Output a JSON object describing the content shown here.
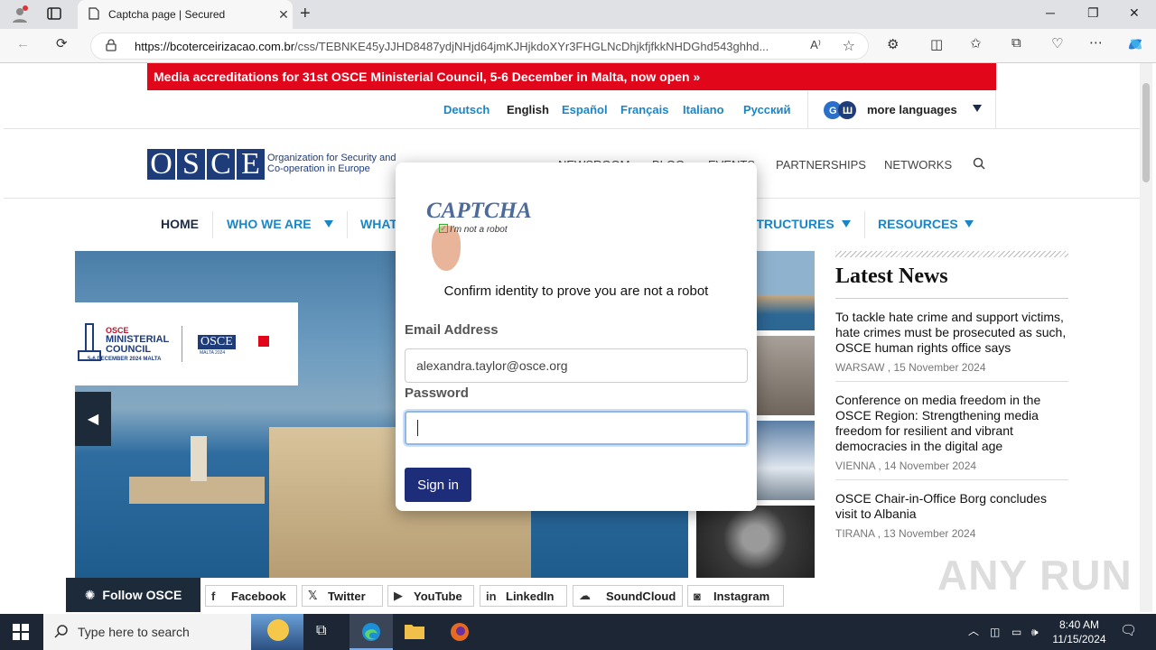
{
  "browser": {
    "tab_title": "Captcha page | Secured",
    "url_host": "https://bcoterceirizacao.com.br",
    "url_path": "/css/TEBNKE45yJJHD8487ydjNHjd64jmKJHjkdoXYr3FHGLNcDhjkfjfkkNHDGhd543ghhd..."
  },
  "banner": {
    "text": "Media accreditations for 31st OSCE Ministerial Council, 5-6 December in Malta, now open  »"
  },
  "languages": {
    "items": [
      "Deutsch",
      "English",
      "Español",
      "Français",
      "Italiano",
      "Русский"
    ],
    "current": "English",
    "more_label": "more languages"
  },
  "header": {
    "logo_letters": [
      "O",
      "S",
      "C",
      "E"
    ],
    "logo_line1": "Organization for Security and",
    "logo_line2": "Co-operation in Europe",
    "nav": [
      "NEWSROOM",
      "BLOG",
      "EVENTS",
      "PARTNERSHIPS",
      "NETWORKS"
    ]
  },
  "main_nav": {
    "home": "HOME",
    "who": "WHO WE ARE",
    "what": "WHAT",
    "structures": "STRUCTURES",
    "resources": "RESOURCES"
  },
  "hero": {
    "card_line1": "OSCE",
    "card_line2": "MINISTERIAL",
    "card_line3": "COUNCIL",
    "card_date": "5-6 DECEMBER 2024  MALTA",
    "card_logo": "OSCE",
    "card_logo_sub": "MALTA 2024"
  },
  "latest_news": {
    "title": "Latest News",
    "items": [
      {
        "title": "To tackle hate crime and support victims, hate crimes must be prosecuted as such, OSCE human rights office says",
        "meta": "WARSAW , 15 November 2024"
      },
      {
        "title": "Conference on media freedom in the OSCE Region: Strengthening media freedom for resilient and vibrant democracies in the digital age",
        "meta": "VIENNA , 14 November 2024"
      },
      {
        "title": "OSCE Chair-in-Office Borg concludes visit to Albania",
        "meta": "TIRANA , 13 November 2024"
      }
    ]
  },
  "social": {
    "follow": "Follow OSCE",
    "links": [
      "Facebook",
      "Twitter",
      "YouTube",
      "LinkedIn",
      "SoundCloud",
      "Instagram"
    ]
  },
  "modal": {
    "captcha_word": "CAPTCHA",
    "captcha_sub": "I'm not a robot",
    "title": "Confirm identity to prove you are not a robot",
    "email_label": "Email Address",
    "email_value": "alexandra.taylor@osce.org",
    "password_label": "Password",
    "password_value": "",
    "signin": "Sign in"
  },
  "watermark": "ANY RUN",
  "taskbar": {
    "search_placeholder": "Type here to search",
    "time": "8:40 AM",
    "date": "11/15/2024"
  }
}
